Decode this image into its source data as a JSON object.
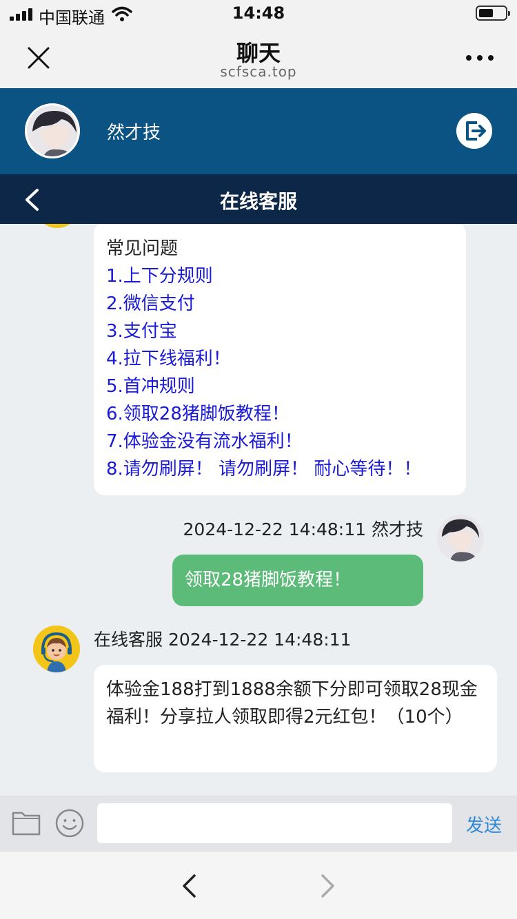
{
  "status_bar": {
    "carrier": "中国联通",
    "time": "14:48"
  },
  "browser": {
    "title": "聊天",
    "url": "scfsca.top"
  },
  "user": {
    "name": "然才技"
  },
  "service_bar": {
    "title": "在线客服"
  },
  "faq": {
    "title": "常见问题",
    "items": [
      "1.上下分规则",
      "2.微信支付",
      "3.支付宝",
      "4.拉下线福利！",
      "5.首冲规则",
      "6.领取28猪脚饭教程！",
      "7.体验金没有流水福利！",
      "8.请勿刷屏！ 请勿刷屏！ 耐心等待！！"
    ]
  },
  "messages": [
    {
      "meta": "2024-12-22 14:48:11 然才技",
      "text": "领取28猪脚饭教程！"
    },
    {
      "meta": "在线客服 2024-12-22 14:48:11",
      "text": "体验金188打到1888余额下分即可领取28现金福利！分享拉人领取即得2元红包！（10个）"
    }
  ],
  "input_bar": {
    "placeholder": "",
    "send_label": "发送"
  },
  "icons": {
    "signal": "signal-icon",
    "wifi": "wifi-icon",
    "battery": "battery-icon",
    "close": "close-icon",
    "more": "more-icon",
    "logout": "logout-icon",
    "back": "chevron-left-icon",
    "folder": "folder-icon",
    "emoji": "emoji-icon",
    "nav_back": "nav-back-icon",
    "nav_forward": "nav-forward-icon"
  },
  "colors": {
    "user_band": "#0b5383",
    "service_bar": "#0c2748",
    "link": "#1a1ad6",
    "my_bubble": "#5dbb7a",
    "send": "#2f88d8",
    "service_avatar": "#f2c518"
  }
}
